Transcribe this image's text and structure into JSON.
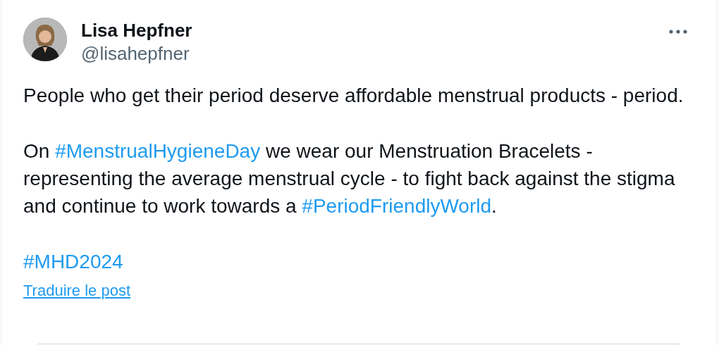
{
  "post": {
    "author": {
      "name": "Lisa Hepfner",
      "handle": "@lisahepfner"
    },
    "paragraphs": [
      [
        {
          "kind": "text",
          "text": "People who get their period deserve affordable menstrual products - period."
        }
      ],
      [
        {
          "kind": "text",
          "text": "On "
        },
        {
          "kind": "hashtag",
          "text": "#MenstrualHygieneDay"
        },
        {
          "kind": "text",
          "text": " we wear our Menstruation Bracelets - representing the average menstrual cycle - to fight back against the stigma and continue to work towards a "
        },
        {
          "kind": "hashtag",
          "text": "#PeriodFriendlyWorld"
        },
        {
          "kind": "text",
          "text": "."
        }
      ],
      [
        {
          "kind": "hashtag",
          "text": "#MHD2024"
        }
      ]
    ],
    "translate_link": "Traduire le post"
  }
}
